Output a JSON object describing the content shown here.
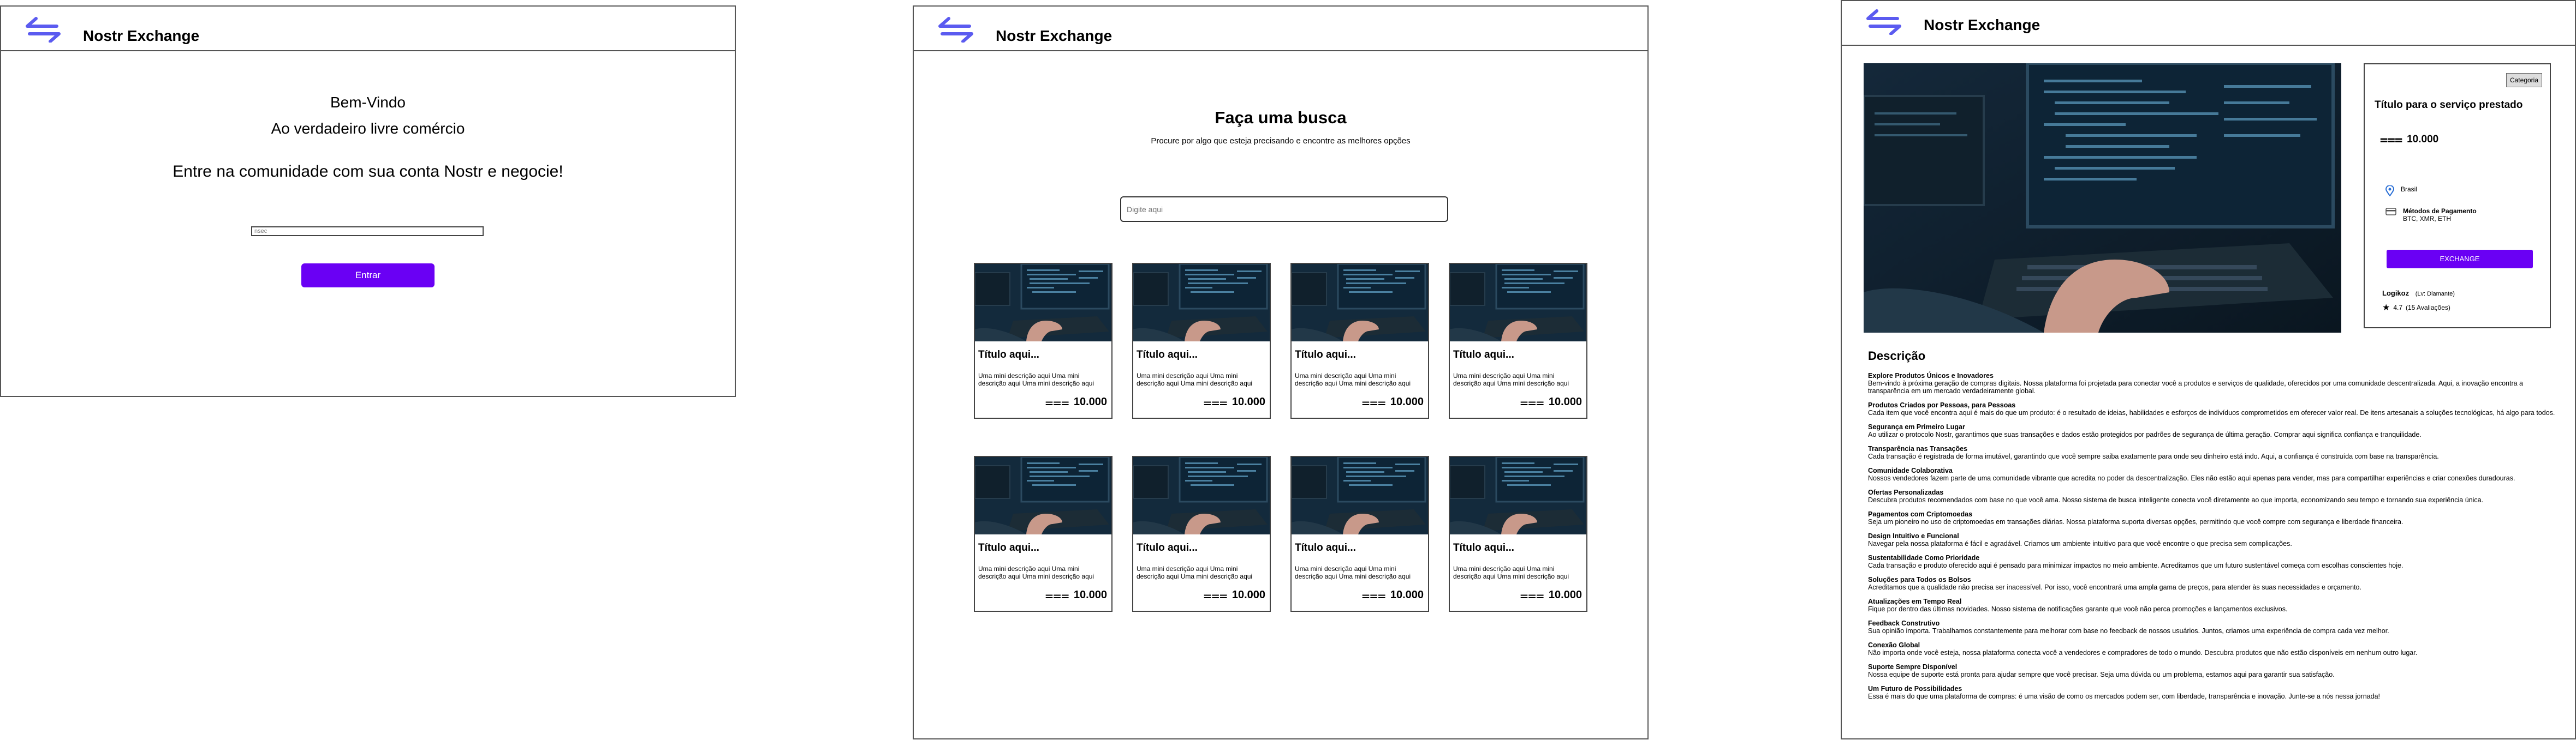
{
  "app": {
    "brand": "Nostr Exchange"
  },
  "login": {
    "welcome": "Bem-Vindo",
    "tagline": "Ao verdadeiro livre comércio",
    "prompt": "Entre na comunidade com sua conta Nostr e negocie!",
    "npub_placeholder": "nsec",
    "enter_label": "Entrar"
  },
  "search_page": {
    "heading": "Faça uma busca",
    "subheading": "Procure por algo que esteja precisando e encontre as melhores opções",
    "search_placeholder": "Digite aqui",
    "cards": [
      {
        "title": "Título aqui...",
        "desc": "Uma mini descrição aqui Uma mini descrição aqui Uma mini descrição aqui",
        "price": "10.000"
      },
      {
        "title": "Título aqui...",
        "desc": "Uma mini descrição aqui Uma mini descrição aqui Uma mini descrição aqui",
        "price": "10.000"
      },
      {
        "title": "Título aqui...",
        "desc": "Uma mini descrição aqui Uma mini descrição aqui Uma mini descrição aqui",
        "price": "10.000"
      },
      {
        "title": "Título aqui...",
        "desc": "Uma mini descrição aqui Uma mini descrição aqui Uma mini descrição aqui",
        "price": "10.000"
      },
      {
        "title": "Título aqui...",
        "desc": "Uma mini descrição aqui Uma mini descrição aqui Uma mini descrição aqui",
        "price": "10.000"
      },
      {
        "title": "Título aqui...",
        "desc": "Uma mini descrição aqui Uma mini descrição aqui Uma mini descrição aqui",
        "price": "10.000"
      },
      {
        "title": "Título aqui...",
        "desc": "Uma mini descrição aqui Uma mini descrição aqui Uma mini descrição aqui",
        "price": "10.000"
      },
      {
        "title": "Título aqui...",
        "desc": "Uma mini descrição aqui Uma mini descrição aqui Uma mini descrição aqui",
        "price": "10.000"
      }
    ]
  },
  "detail": {
    "category": "Categoria",
    "title": "Título para o serviço prestado",
    "price": "10.000",
    "location": "Brasil",
    "payment_label": "Métodos de Pagamento",
    "payment_methods": "BTC, XMR, ETH",
    "exchange_label": "EXCHANGE",
    "seller_name": "Logikoz",
    "seller_level": "(Lv: Diamante)",
    "rating": "4.7",
    "reviews": "(15 Avaliações)",
    "description_heading": "Descrição",
    "sections": [
      {
        "title": "Explore Produtos Únicos e Inovadores",
        "text": "Bem-vindo à próxima geração de compras digitais. Nossa plataforma foi projetada para conectar você a produtos e serviços de qualidade, oferecidos por uma comunidade descentralizada. Aqui, a inovação encontra a transparência em um mercado verdadeiramente global."
      },
      {
        "title": "Produtos Criados por Pessoas, para Pessoas",
        "text": "Cada item que você encontra aqui é mais do que um produto: é o resultado de ideias, habilidades e esforços de indivíduos comprometidos em oferecer valor real. De itens artesanais a soluções tecnológicas, há algo para todos."
      },
      {
        "title": "Segurança em Primeiro Lugar",
        "text": "Ao utilizar o protocolo Nostr, garantimos que suas transações e dados estão protegidos por padrões de segurança de última geração. Comprar aqui significa confiança e tranquilidade."
      },
      {
        "title": "Transparência nas Transações",
        "text": "Cada transação é registrada de forma imutável, garantindo que você sempre saiba exatamente para onde seu dinheiro está indo. Aqui, a confiança é construída com base na transparência."
      },
      {
        "title": "Comunidade Colaborativa",
        "text": "Nossos vendedores fazem parte de uma comunidade vibrante que acredita no poder da descentralização. Eles não estão aqui apenas para vender, mas para compartilhar experiências e criar conexões duradouras."
      },
      {
        "title": "Ofertas Personalizadas",
        "text": "Descubra produtos recomendados com base no que você ama. Nosso sistema de busca inteligente conecta você diretamente ao que importa, economizando seu tempo e tornando sua experiência única."
      },
      {
        "title": "Pagamentos com Criptomoedas",
        "text": "Seja um pioneiro no uso de criptomoedas em transações diárias. Nossa plataforma suporta diversas opções, permitindo que você compre com segurança e liberdade financeira."
      },
      {
        "title": "Design Intuitivo e Funcional",
        "text": "Navegar pela nossa plataforma é fácil e agradável. Criamos um ambiente intuitivo para que você encontre o que precisa sem complicações."
      },
      {
        "title": "Sustentabilidade Como Prioridade",
        "text": "Cada transação e produto oferecido aqui é pensado para minimizar impactos no meio ambiente. Acreditamos que um futuro sustentável começa com escolhas conscientes hoje."
      },
      {
        "title": "Soluções para Todos os Bolsos",
        "text": "Acreditamos que a qualidade não precisa ser inacessível. Por isso, você encontrará uma ampla gama de preços, para atender às suas necessidades e orçamento."
      },
      {
        "title": "Atualizações em Tempo Real",
        "text": "Fique por dentro das últimas novidades. Nosso sistema de notificações garante que você não perca promoções e lançamentos exclusivos."
      },
      {
        "title": "Feedback Construtivo",
        "text": "Sua opinião importa. Trabalhamos constantemente para melhorar com base no feedback de nossos usuários. Juntos, criamos uma experiência de compra cada vez melhor."
      },
      {
        "title": "Conexão Global",
        "text": "Não importa onde você esteja, nossa plataforma conecta você a vendedores e compradores de todo o mundo. Descubra produtos que não estão disponíveis em nenhum outro lugar."
      },
      {
        "title": "Suporte Sempre Disponível",
        "text": "Nossa equipe de suporte está pronta para ajudar sempre que você precisar. Seja uma dúvida ou um problema, estamos aqui para garantir sua satisfação."
      },
      {
        "title": "Um Futuro de Possibilidades",
        "text": "Essa é mais do que uma plataforma de compras: é uma visão de como os mercados podem ser, com liberdade, transparência e inovação. Junte-se a nós nessa jornada!"
      }
    ]
  },
  "colors": {
    "accent": "#6a00f4",
    "logo": "#5b5bf0",
    "border": "#555555"
  }
}
